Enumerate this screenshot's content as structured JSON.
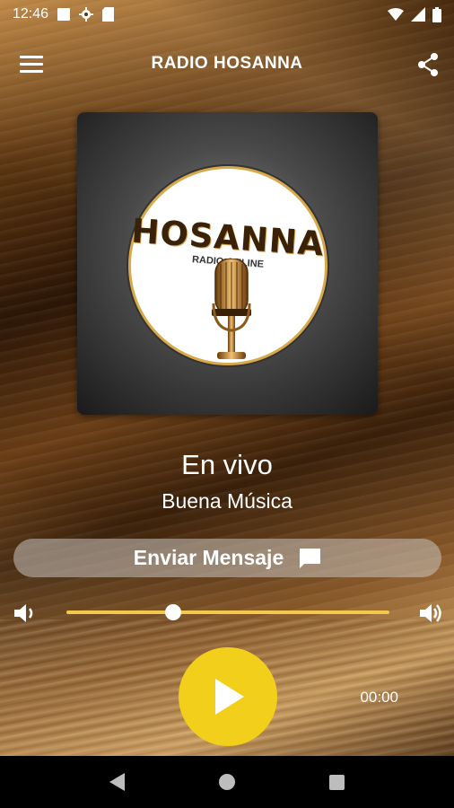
{
  "status_bar": {
    "time": "12:46",
    "icons": [
      "notification-square-icon",
      "settings-gear-icon",
      "sd-card-icon",
      "wifi-icon",
      "signal-icon",
      "battery-icon"
    ]
  },
  "app_bar": {
    "title": "RADIO HOSANNA",
    "menu_icon": "hamburger-menu-icon",
    "share_icon": "share-icon"
  },
  "cover": {
    "logo_title": "HOSANNA",
    "logo_subtitle": "RADIO ONLINE"
  },
  "now_playing": {
    "title": "En vivo",
    "subtitle": "Buena Música"
  },
  "message_button": {
    "label": "Enviar Mensaje",
    "icon": "message-bubble-icon"
  },
  "volume": {
    "level": 0.33,
    "low_icon": "volume-low-icon",
    "high_icon": "volume-high-icon"
  },
  "player": {
    "play_icon": "play-icon",
    "elapsed": "00:00"
  },
  "colors": {
    "accent": "#f2cf1a",
    "slider": "#f2c94c",
    "nav_bar": "#000000"
  }
}
